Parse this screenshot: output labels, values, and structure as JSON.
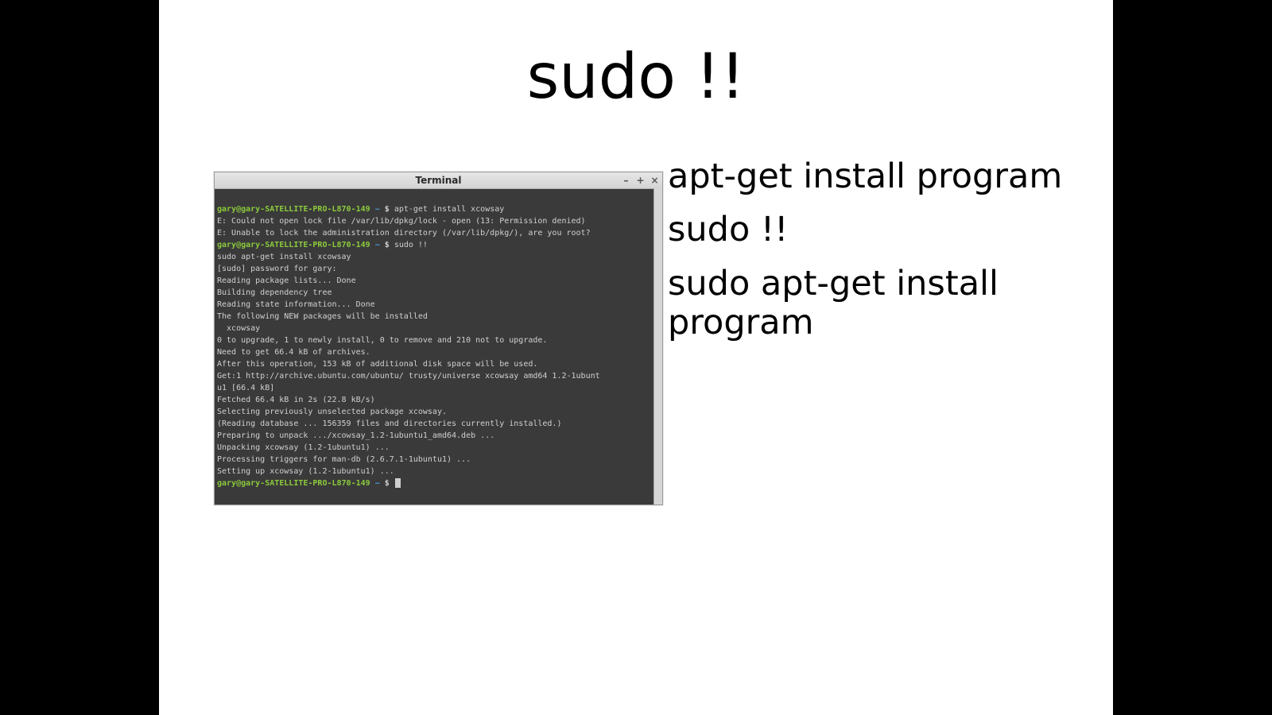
{
  "slide": {
    "title": "sudo !!",
    "bullets": [
      "apt-get install program",
      "sudo !!",
      "sudo apt-get install program"
    ]
  },
  "terminal": {
    "window_title": "Terminal",
    "buttons": {
      "minimize": "–",
      "maximize": "+",
      "close": "×"
    },
    "prompt_user_host": "gary@gary-SATELLITE-PRO-L870-149",
    "prompt_path": "~",
    "prompt_symbol": "$",
    "commands": {
      "cmd1": "apt-get install xcowsay",
      "cmd2": "sudo !!"
    },
    "output": {
      "l1": "E: Could not open lock file /var/lib/dpkg/lock - open (13: Permission denied)",
      "l2": "E: Unable to lock the administration directory (/var/lib/dpkg/), are you root?",
      "l3": "sudo apt-get install xcowsay",
      "l4": "[sudo] password for gary:",
      "l5": "Reading package lists... Done",
      "l6": "Building dependency tree",
      "l7": "Reading state information... Done",
      "l8": "The following NEW packages will be installed",
      "l9": "  xcowsay",
      "l10": "0 to upgrade, 1 to newly install, 0 to remove and 210 not to upgrade.",
      "l11": "Need to get 66.4 kB of archives.",
      "l12": "After this operation, 153 kB of additional disk space will be used.",
      "l13": "Get:1 http://archive.ubuntu.com/ubuntu/ trusty/universe xcowsay amd64 1.2-1ubunt",
      "l14": "u1 [66.4 kB]",
      "l15": "Fetched 66.4 kB in 2s (22.8 kB/s)",
      "l16": "Selecting previously unselected package xcowsay.",
      "l17": "(Reading database ... 156359 files and directories currently installed.)",
      "l18": "Preparing to unpack .../xcowsay_1.2-1ubuntu1_amd64.deb ...",
      "l19": "Unpacking xcowsay (1.2-1ubuntu1) ...",
      "l20": "Processing triggers for man-db (2.6.7.1-1ubuntu1) ...",
      "l21": "Setting up xcowsay (1.2-1ubuntu1) ..."
    }
  }
}
